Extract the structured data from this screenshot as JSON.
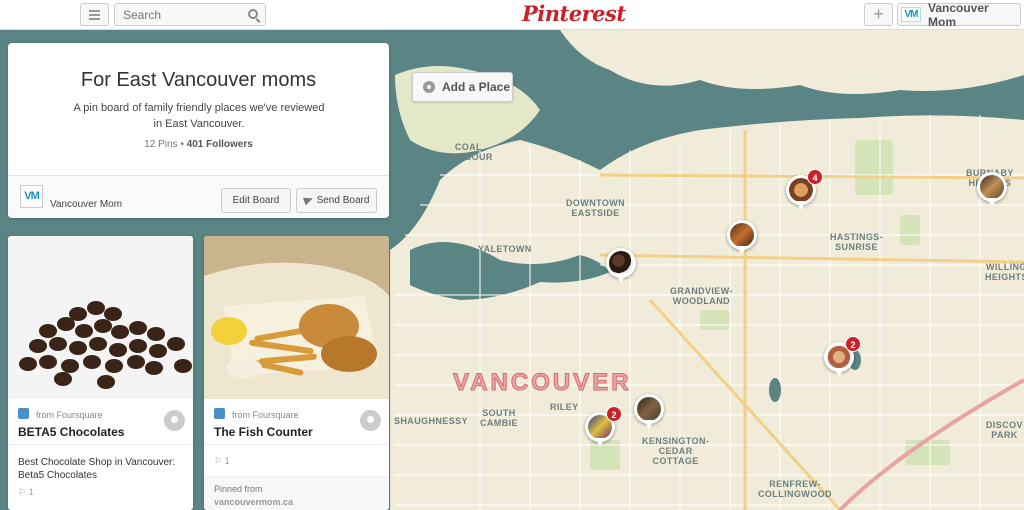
{
  "header": {
    "search_placeholder": "Search",
    "logo_text": "Pinterest",
    "add_label": "+",
    "user_badge": "VM",
    "user_name": "Vancouver Mom"
  },
  "map": {
    "add_place_label": "Add a Place",
    "city_label": "VANCOUVER",
    "labels": [
      {
        "text": "COAL\nHARBOUR"
      },
      {
        "text": "DOWNTOWN\nEASTSIDE"
      },
      {
        "text": "YALETOWN"
      },
      {
        "text": "GRANDVIEW-\nWOODLAND"
      },
      {
        "text": "HASTINGS-\nSUNRISE"
      },
      {
        "text": "BURNABY\nHEIGHTS"
      },
      {
        "text": "WILLING\nHEIGHTS"
      },
      {
        "text": "SHAUGHNESSY"
      },
      {
        "text": "SOUTH\nCAMBIE"
      },
      {
        "text": "RILEY"
      },
      {
        "text": "KENSINGTON-\nCEDAR\nCOTTAGE"
      },
      {
        "text": "RENFREW-\nCOLLINGWOOD"
      },
      {
        "text": "DISCOV\nPARK"
      }
    ],
    "markers": [
      {
        "name": "marker-chocolates",
        "count": ""
      },
      {
        "name": "marker-grandview",
        "count": ""
      },
      {
        "name": "marker-hastings",
        "count": "4"
      },
      {
        "name": "marker-burnaby",
        "count": ""
      },
      {
        "name": "marker-renfrew",
        "count": "2"
      },
      {
        "name": "marker-riley",
        "count": "2"
      },
      {
        "name": "marker-kensington",
        "count": ""
      }
    ]
  },
  "board": {
    "title": "For East Vancouver moms",
    "description": "A pin board of family friendly places we've reviewed in East Vancouver.",
    "pins_count": "12 Pins",
    "separator": "•",
    "followers_count": "401 Followers",
    "owner_badge": "VM",
    "owner_name": "Vancouver Mom",
    "edit_label": "Edit Board",
    "send_label": "Send Board"
  },
  "pins": [
    {
      "source": "from Foursquare",
      "name": "BETA5 Chocolates",
      "description": "Best Chocolate Shop in Vancouver: Beta5 Chocolates",
      "likes": "1"
    },
    {
      "source": "from Foursquare",
      "name": "The Fish Counter",
      "likes": "1",
      "pinned_from_label": "Pinned from",
      "pinned_from_url": "vancouvermom.ca"
    }
  ],
  "colors": {
    "brand": "#cb2027",
    "water": "#5a8584",
    "land": "#f1ecd9"
  }
}
